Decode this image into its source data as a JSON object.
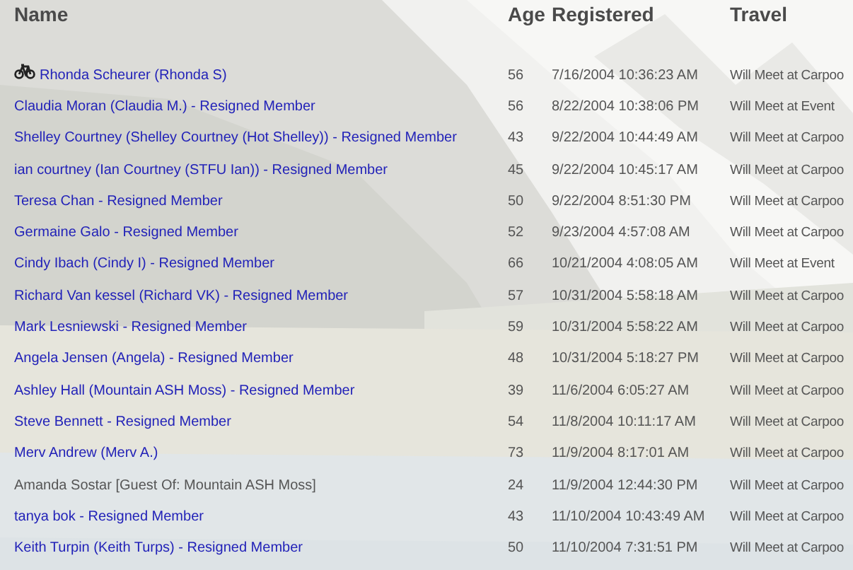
{
  "table": {
    "columns": [
      "Name",
      "Age",
      "Registered",
      "Travel"
    ],
    "rows": [
      {
        "kind": "member_with_icon",
        "name": "Rhonda Scheurer (Rhonda S)",
        "age": "56",
        "registered": "7/16/2004 10:36:23 AM",
        "travel": "Will Meet at Carpoo"
      },
      {
        "kind": "member",
        "name": "Claudia Moran (Claudia M.) - Resigned Member",
        "age": "56",
        "registered": "8/22/2004 10:38:06 PM",
        "travel": "Will Meet at Event"
      },
      {
        "kind": "member",
        "name": "Shelley Courtney (Shelley Courtney (Hot Shelley)) - Resigned Member",
        "age": "43",
        "registered": "9/22/2004 10:44:49 AM",
        "travel": "Will Meet at Carpoo"
      },
      {
        "kind": "member",
        "name": "ian courtney (Ian Courtney (STFU Ian)) - Resigned Member",
        "age": "45",
        "registered": "9/22/2004 10:45:17 AM",
        "travel": "Will Meet at Carpoo"
      },
      {
        "kind": "member",
        "name": "Teresa Chan - Resigned Member",
        "age": "50",
        "registered": "9/22/2004 8:51:30 PM",
        "travel": "Will Meet at Carpoo"
      },
      {
        "kind": "member",
        "name": "Germaine Galo - Resigned Member",
        "age": "52",
        "registered": "9/23/2004 4:57:08 AM",
        "travel": "Will Meet at Carpoo"
      },
      {
        "kind": "member",
        "name": "Cindy Ibach (Cindy I) - Resigned Member",
        "age": "66",
        "registered": "10/21/2004 4:08:05 AM",
        "travel": "Will Meet at Event"
      },
      {
        "kind": "member",
        "name": "Richard Van kessel (Richard VK) - Resigned Member",
        "age": "57",
        "registered": "10/31/2004 5:58:18 AM",
        "travel": "Will Meet at Carpoo"
      },
      {
        "kind": "member",
        "name": "Mark Lesniewski - Resigned Member",
        "age": "59",
        "registered": "10/31/2004 5:58:22 AM",
        "travel": "Will Meet at Carpoo"
      },
      {
        "kind": "member",
        "name": "Angela Jensen (Angela) - Resigned Member",
        "age": "48",
        "registered": "10/31/2004 5:18:27 PM",
        "travel": "Will Meet at Carpoo"
      },
      {
        "kind": "member",
        "name": "Ashley Hall (Mountain ASH Moss) - Resigned Member",
        "age": "39",
        "registered": "11/6/2004 6:05:27 AM",
        "travel": "Will Meet at Carpoo"
      },
      {
        "kind": "member",
        "name": "Steve Bennett - Resigned Member",
        "age": "54",
        "registered": "11/8/2004 10:11:17 AM",
        "travel": "Will Meet at Carpoo"
      },
      {
        "kind": "member",
        "name": "Merv Andrew (Merv A.)",
        "age": "73",
        "registered": "11/9/2004 8:17:01 AM",
        "travel": "Will Meet at Carpoo"
      },
      {
        "kind": "guest",
        "name": "Amanda Sostar [Guest Of: Mountain ASH Moss]",
        "age": "24",
        "registered": "11/9/2004 12:44:30 PM",
        "travel": "Will Meet at Carpoo"
      },
      {
        "kind": "member",
        "name": "tanya bok - Resigned Member",
        "age": "43",
        "registered": "11/10/2004 10:43:49 AM",
        "travel": "Will Meet at Carpoo"
      },
      {
        "kind": "member",
        "name": "Keith Turpin (Keith Turps) - Resigned Member",
        "age": "50",
        "registered": "11/10/2004 7:31:51 PM",
        "travel": "Will Meet at Carpoo"
      }
    ]
  }
}
